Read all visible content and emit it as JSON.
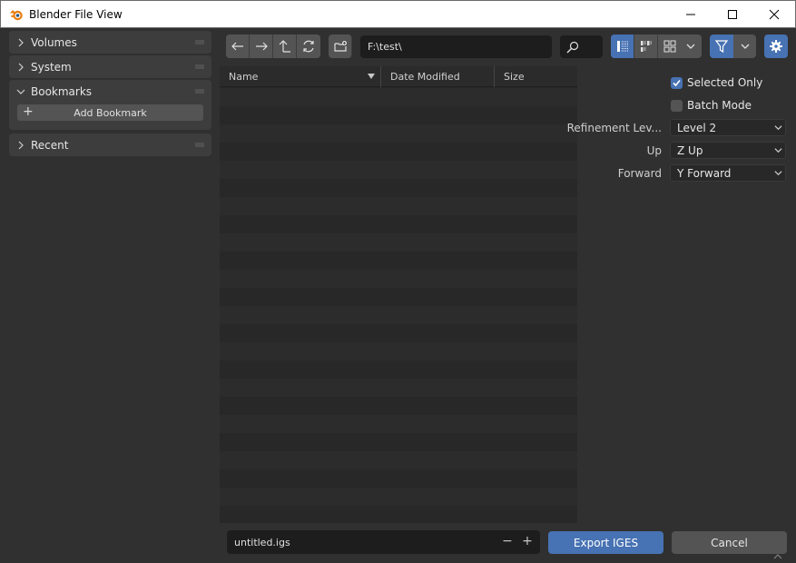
{
  "window": {
    "title": "Blender File View",
    "icon": "blender-logo-icon",
    "minimize_icon": "minimize-icon",
    "maximize_icon": "maximize-icon",
    "close_icon": "close-icon"
  },
  "sidebar": {
    "panels": [
      {
        "label": "Volumes",
        "expanded": false
      },
      {
        "label": "System",
        "expanded": false
      },
      {
        "label": "Bookmarks",
        "expanded": true
      },
      {
        "label": "Recent",
        "expanded": false
      }
    ],
    "add_bookmark_label": "Add Bookmark"
  },
  "toolbar": {
    "nav_icons": [
      "arrow-left-icon",
      "arrow-right-icon",
      "parent-directory-icon",
      "refresh-icon"
    ],
    "new_folder_icon": "new-folder-icon",
    "path": "F:\\test\\",
    "search_icon": "search-icon",
    "view_modes": [
      {
        "icon": "vertical-list-icon",
        "active": true
      },
      {
        "icon": "horizontal-list-icon",
        "active": false
      },
      {
        "icon": "thumbnails-icon",
        "active": false
      }
    ],
    "filter_active": true,
    "settings_active": true
  },
  "file_list": {
    "columns": [
      "Name",
      "Date Modified",
      "Size"
    ],
    "sorted_by": "Name",
    "rows": []
  },
  "options": {
    "selected_only": {
      "label": "Selected Only",
      "checked": true
    },
    "batch_mode": {
      "label": "Batch Mode",
      "checked": false
    },
    "refinement": {
      "label": "Refinement Lev...",
      "value": "Level 2"
    },
    "up": {
      "label": "Up",
      "value": "Z Up"
    },
    "forward": {
      "label": "Forward",
      "value": "Y Forward"
    }
  },
  "footer": {
    "filename": "untitled.igs",
    "export_label": "Export IGES",
    "cancel_label": "Cancel"
  },
  "colors": {
    "accent": "#4772b3",
    "background": "#303030",
    "panel": "#3d3d3d",
    "field": "#1d1d1d",
    "button": "#545454"
  }
}
